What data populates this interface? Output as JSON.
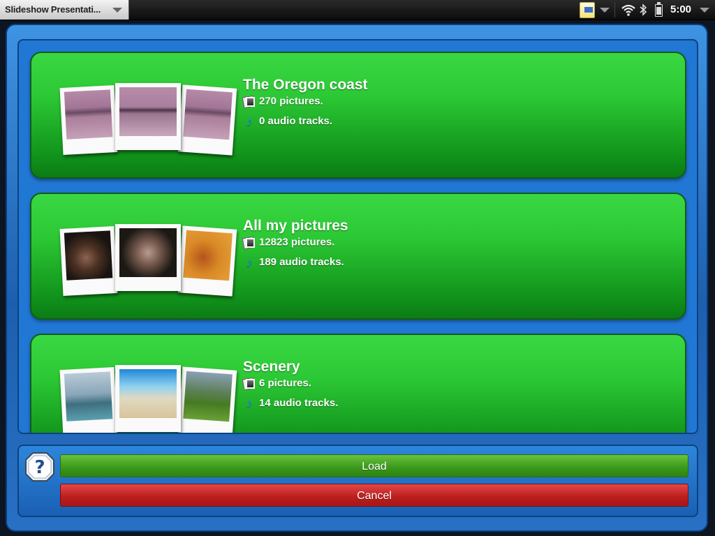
{
  "status_bar": {
    "app_title": "Slideshow Presentati...",
    "clock": "5:00",
    "icons": [
      "notification-icon",
      "wifi-icon",
      "bluetooth-icon",
      "battery-icon"
    ]
  },
  "slideshows": [
    {
      "title": "The Oregon coast",
      "pictures": "270 pictures.",
      "audio": "0 audio tracks.",
      "thumbnails": [
        "beach-dusk",
        "beach-dusk",
        "beach-dusk"
      ]
    },
    {
      "title": "All my pictures",
      "pictures": "12823 pictures.",
      "audio": "189 audio tracks.",
      "thumbnails": [
        "dog-sleeping",
        "dog-face",
        "orange-dog"
      ]
    },
    {
      "title": "Scenery",
      "pictures": "6 pictures.",
      "audio": "14 audio tracks.",
      "thumbnails": [
        "island-lagoon",
        "sunny-beach",
        "green-valley"
      ]
    }
  ],
  "actions": {
    "load_label": "Load",
    "cancel_label": "Cancel",
    "help_icon": "help-icon"
  },
  "colors": {
    "card_green": "#2cc835",
    "frame_blue": "#2177d4",
    "load_green": "#3c9a1c",
    "cancel_red": "#be1f1f"
  }
}
